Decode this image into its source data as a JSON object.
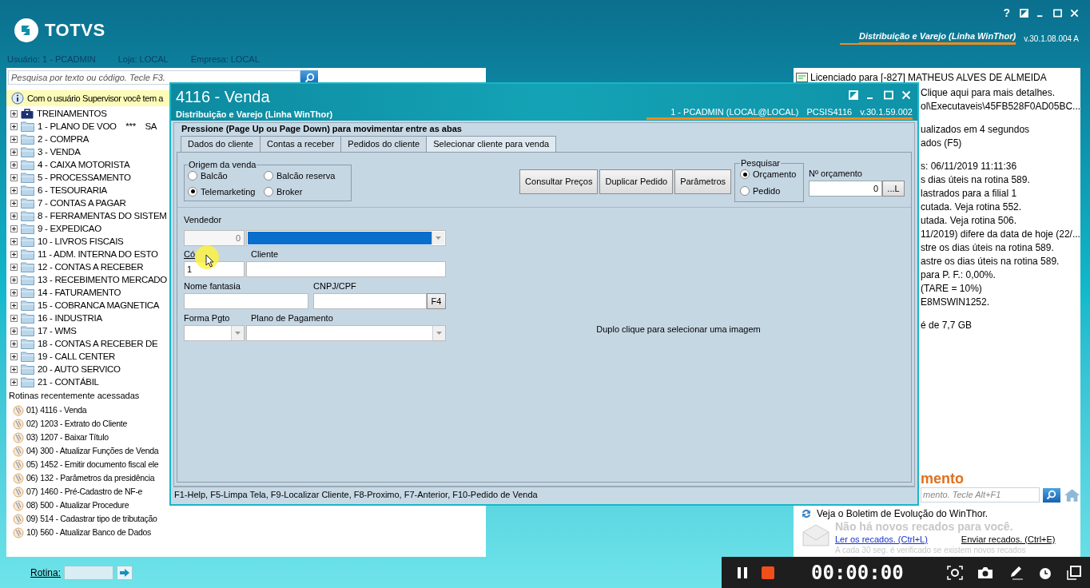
{
  "app": {
    "logo": "TOTVS",
    "help": "?",
    "product_link": "Distribuição e Varejo (Linha WinThor)",
    "version": "v.30.1.08.004 A"
  },
  "session": [
    "Usuário: 1 - PCADMIN",
    "Loja: LOCAL",
    "Empresa: LOCAL"
  ],
  "search": {
    "placeholder": "Pesquisa por texto ou código. Tecle F3."
  },
  "notice": "Com o usuário Supervisor você tem a",
  "menu_tree": [
    {
      "label": "TREINAMENTOS",
      "kind": "briefcase",
      "expanded": false
    },
    {
      "label": "1 - PLANO DE VOO    ***    SA",
      "kind": "folder",
      "expanded": false
    },
    {
      "label": "2 - COMPRA",
      "kind": "folder",
      "expanded": false
    },
    {
      "label": "3 - VENDA",
      "kind": "folder",
      "expanded": false
    },
    {
      "label": "4 - CAIXA MOTORISTA",
      "kind": "folder",
      "expanded": false
    },
    {
      "label": "5 - PROCESSAMENTO",
      "kind": "folder",
      "expanded": false
    },
    {
      "label": "6 - TESOURARIA",
      "kind": "folder",
      "expanded": false
    },
    {
      "label": "7 - CONTAS A PAGAR",
      "kind": "folder",
      "expanded": false
    },
    {
      "label": "8 - FERRAMENTAS DO SISTEM",
      "kind": "folder",
      "expanded": false
    },
    {
      "label": "9 - EXPEDICAO",
      "kind": "folder",
      "expanded": false
    },
    {
      "label": "10 - LIVROS FISCAIS",
      "kind": "folder",
      "expanded": false
    },
    {
      "label": "11 - ADM. INTERNA DO ESTO",
      "kind": "folder",
      "expanded": false
    },
    {
      "label": "12 - CONTAS A RECEBER",
      "kind": "folder",
      "expanded": false
    },
    {
      "label": "13 - RECEBIMENTO MERCADO",
      "kind": "folder",
      "expanded": false
    },
    {
      "label": "14 - FATURAMENTO",
      "kind": "folder",
      "expanded": false
    },
    {
      "label": "15 - COBRANCA MAGNETICA",
      "kind": "folder",
      "expanded": false
    },
    {
      "label": "16 - INDUSTRIA",
      "kind": "folder",
      "expanded": false
    },
    {
      "label": "17 - WMS",
      "kind": "folder",
      "expanded": false
    },
    {
      "label": "18 - CONTAS A RECEBER DE",
      "kind": "folder",
      "expanded": false
    },
    {
      "label": "19 - CALL CENTER",
      "kind": "folder",
      "expanded": false
    },
    {
      "label": "20 - AUTO SERVICO",
      "kind": "folder",
      "expanded": false
    },
    {
      "label": "21 - CONTÁBIL",
      "kind": "folder",
      "expanded": false
    }
  ],
  "recent": {
    "title": "Rotinas recentemente acessadas",
    "items": [
      {
        "number": "01)",
        "label": "4116 - Venda"
      },
      {
        "number": "02)",
        "label": "1203 - Extrato do Cliente"
      },
      {
        "number": "03)",
        "label": "1207 - Baixar Título"
      },
      {
        "number": "04)",
        "label": "300 - Atualizar Funções de Venda"
      },
      {
        "number": "05)",
        "label": "1452 - Emitir documento fiscal ele"
      },
      {
        "number": "06)",
        "label": "132 - Parâmetros da presidência"
      },
      {
        "number": "07)",
        "label": "1460 - Pré-Cadastro de NF-e"
      },
      {
        "number": "08)",
        "label": "500 - Atualizar Procedure"
      },
      {
        "number": "09)",
        "label": "514 - Cadastrar tipo de tributação"
      },
      {
        "number": "10)",
        "label": "560 - Atualizar Banco de Dados"
      }
    ]
  },
  "rotina": {
    "label": "Rotina:"
  },
  "right_panel": {
    "license": "Licenciado para [-827] MATHEUS ALVES DE ALMEIDA",
    "line_groups": [
      [
        "Clique aqui para mais detalhes.",
        "ol\\Executaveis\\45FB528F0AD05BC..."
      ],
      [
        "ualizados em 4 segundos",
        "ados (F5)"
      ],
      [
        "s: 06/11/2019 11:11:36",
        "s dias úteis na rotina 589.",
        "lastrados para a filial 1",
        "cutada. Veja rotina 552.",
        "utada. Veja rotina 506.",
        "11/2019) difere da data de hoje (22/...",
        "stre os dias úteis na rotina 589.",
        "astre os dias úteis na rotina 589.",
        "para P. F.: 0,00%.",
        "(TARE = 10%)",
        "E8MSWIN1252."
      ],
      [
        "é de 7,7 GB"
      ]
    ],
    "section_title": "mento",
    "search": {
      "placeholder": "mento. Tecle Alt+F1"
    },
    "bulletin": "Veja o Boletim de Evolução do WinThor.",
    "no_messages": "Não há novos recados para você.",
    "read_link": "Ler os recados. (Ctrl+L)",
    "send_link": "Enviar recados. (Ctrl+E)",
    "note": "A cada 30 seg. é verificado se existem novos recados"
  },
  "dialog": {
    "title": "4116 - Venda",
    "subtitle": "Distribuição e Varejo (Linha WinThor)",
    "session": "1 - PCADMIN (LOCAL@LOCAL)",
    "program": "PCSIS4116",
    "version": "v.30.1.59.002",
    "hint": "Pressione (Page Up ou Page Down) para movimentar entre as abas",
    "tabs": [
      {
        "label": "Dados do cliente",
        "selected": false
      },
      {
        "label": "Contas a receber",
        "selected": false
      },
      {
        "label": "Pedidos do cliente",
        "selected": false
      },
      {
        "label": "Selecionar cliente para venda",
        "selected": true
      }
    ],
    "origin": {
      "legend": "Origem da venda",
      "options": [
        {
          "label": "Balcão",
          "selected": false
        },
        {
          "label": "Balcão reserva",
          "selected": false
        },
        {
          "label": "Telemarketing",
          "selected": true
        },
        {
          "label": "Broker",
          "selected": false
        }
      ]
    },
    "buttons": [
      "Consultar Preços",
      "Duplicar Pedido",
      "Parâmetros"
    ],
    "search_by": {
      "legend": "Pesquisar",
      "options": [
        {
          "label": "Orçamento",
          "selected": true
        },
        {
          "label": "Pedido",
          "selected": false
        }
      ]
    },
    "budget": {
      "label": "Nº orçamento",
      "value": "0",
      "lookup": "...L"
    },
    "seller": {
      "label": "Vendedor",
      "code": "0",
      "highlighted": true
    },
    "client": {
      "code_label": "Có",
      "code": "1",
      "name_label": "Cliente"
    },
    "fantasy": {
      "label": "Nome fantasia"
    },
    "document": {
      "label": "CNPJ/CPF",
      "button": "F4"
    },
    "payment": {
      "method_label": "Forma Pgto",
      "plan_label": "Plano de Pagamento"
    },
    "image_hint": "Duplo clique para selecionar uma imagem",
    "status_bar": "F1-Help, F5-Limpa Tela, F9-Localizar Cliente, F8-Proximo, F7-Anterior, F10-Pedido de Venda"
  },
  "recorder": {
    "time": "00:00:00"
  }
}
